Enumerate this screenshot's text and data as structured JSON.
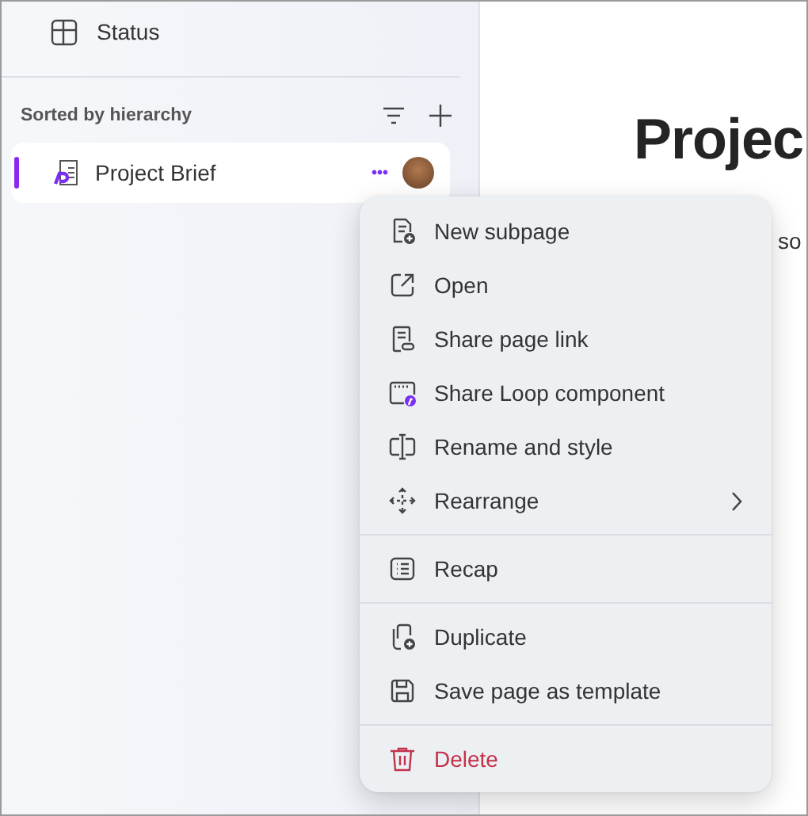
{
  "sidebar": {
    "nav_item": {
      "label": "Status"
    },
    "section": {
      "title": "Sorted by hierarchy"
    },
    "pages": [
      {
        "label": "Project Brief",
        "selected": true,
        "more": "•••"
      }
    ]
  },
  "main": {
    "heading": "Projec",
    "body_text": "so"
  },
  "context_menu": {
    "groups": [
      {
        "items": [
          {
            "label": "New subpage",
            "submenu": false,
            "danger": false
          },
          {
            "label": "Open",
            "submenu": false,
            "danger": false
          },
          {
            "label": "Share page link",
            "submenu": false,
            "danger": false
          },
          {
            "label": "Share Loop component",
            "submenu": false,
            "danger": false
          },
          {
            "label": "Rename and style",
            "submenu": false,
            "danger": false
          },
          {
            "label": "Rearrange",
            "submenu": true,
            "danger": false
          }
        ]
      },
      {
        "items": [
          {
            "label": "Recap",
            "submenu": false,
            "danger": false
          }
        ]
      },
      {
        "items": [
          {
            "label": "Duplicate",
            "submenu": false,
            "danger": false
          },
          {
            "label": "Save page as template",
            "submenu": false,
            "danger": false
          }
        ]
      },
      {
        "items": [
          {
            "label": "Delete",
            "submenu": false,
            "danger": true
          }
        ]
      }
    ]
  }
}
